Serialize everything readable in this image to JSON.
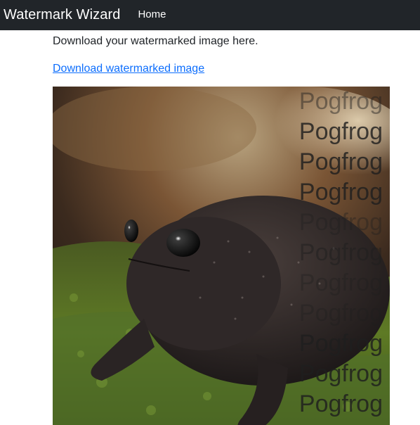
{
  "navbar": {
    "brand": "Watermark Wizard",
    "links": [
      "Home"
    ]
  },
  "main": {
    "message": "Download your watermarked image here.",
    "download_link": "Download watermarked image"
  },
  "image": {
    "subject": "black rain frog on moss",
    "watermark_text": "Pogfrog",
    "watermark_lines": [
      "Pogfrog",
      "Pogfrog",
      "Pogfrog",
      "Pogfrog",
      "Pogfrog",
      "Pogfrog",
      "Pogfrog",
      "Pogfrog",
      "Pogfrog",
      "Pogfrog",
      "Pogfrog"
    ]
  },
  "colors": {
    "navbar_bg": "#212529",
    "link": "#0d6efd",
    "text": "#212529"
  }
}
